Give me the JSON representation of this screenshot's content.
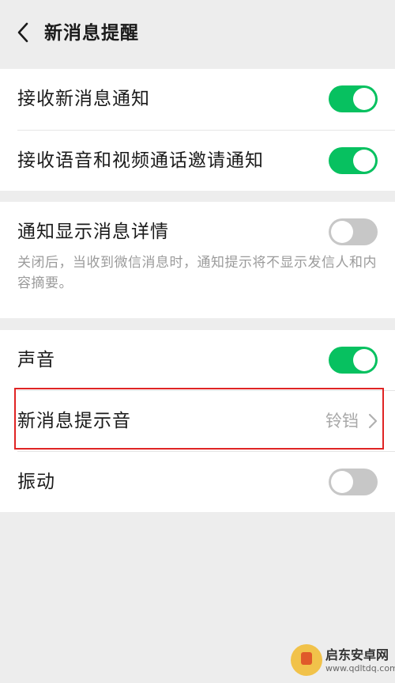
{
  "header": {
    "title": "新消息提醒"
  },
  "group1": {
    "items": [
      {
        "label": "接收新消息通知",
        "toggle": "on"
      },
      {
        "label": "接收语音和视频通话邀请通知",
        "toggle": "on"
      }
    ]
  },
  "group2": {
    "label": "通知显示消息详情",
    "toggle": "off",
    "description": "关闭后，当收到微信消息时，通知提示将不显示发信人和内容摘要。"
  },
  "group3": {
    "sound": {
      "label": "声音",
      "toggle": "on"
    },
    "ringtone": {
      "label": "新消息提示音",
      "value": "铃铛"
    },
    "vibrate": {
      "label": "振动",
      "toggle": "off"
    }
  },
  "watermark": {
    "name": "启东安卓网",
    "url": "www.qdltdq.com"
  },
  "colors": {
    "accent": "#07c160",
    "toggle_off": "#c7c7c7",
    "highlight": "#e02424"
  }
}
